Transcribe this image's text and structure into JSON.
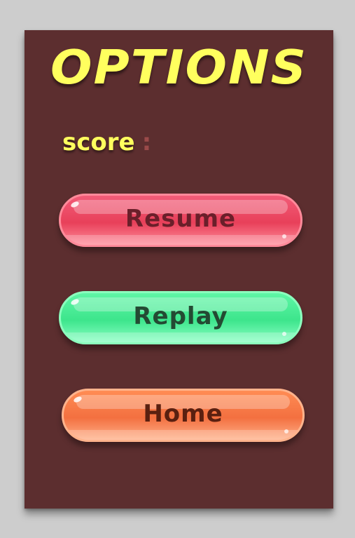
{
  "menu": {
    "title": "OPTIONS",
    "score_label": "score",
    "score_separator": ":",
    "score_value": ""
  },
  "buttons": {
    "resume": "Resume",
    "replay": "Replay",
    "home": "Home"
  },
  "colors": {
    "panel_background": "#5c2e2f",
    "title": "#ffff5e",
    "resume": "#e8405a",
    "replay": "#3de58c",
    "home": "#f37040"
  }
}
